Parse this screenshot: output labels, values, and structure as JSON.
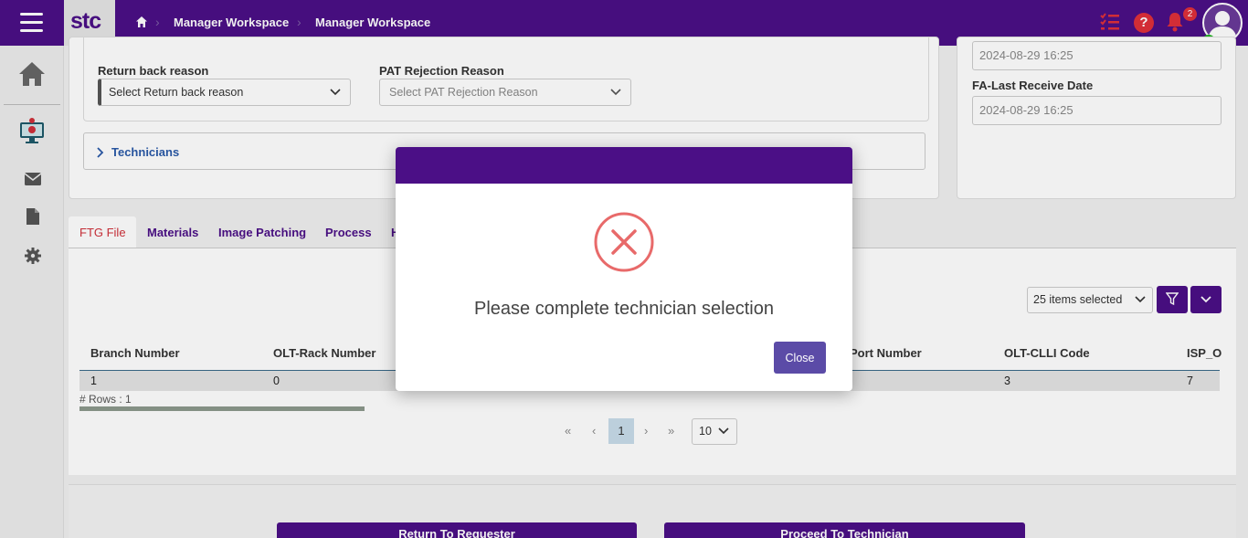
{
  "header": {
    "logo": "stc",
    "breadcrumbs": [
      "Manager Workspace",
      "Manager Workspace"
    ],
    "notification_count": "2"
  },
  "form": {
    "return_reason_label": "Return back reason",
    "return_reason_value": "Select Return back reason",
    "pat_label": "PAT Rejection Reason",
    "pat_value": "Select PAT Rejection Reason",
    "technicians_label": "Technicians"
  },
  "side_panel": {
    "date1_value": "2024-08-29 16:25",
    "date2_label": "FA-Last Receive Date",
    "date2_value": "2024-08-29 16:25"
  },
  "tabs": [
    {
      "label": "FTG File",
      "active": true
    },
    {
      "label": "Materials"
    },
    {
      "label": "Image Patching"
    },
    {
      "label": "Process"
    },
    {
      "label": "H"
    }
  ],
  "table": {
    "items_selected": "25 items selected",
    "columns": [
      "Branch Number",
      "OLT-Rack Number",
      "Port Number",
      "OLT-CLLI Code",
      "ISP_O"
    ],
    "row": [
      "1",
      "0",
      "3",
      "7"
    ],
    "rows_count": "# Rows : 1"
  },
  "pagination": {
    "first": "«",
    "prev": "‹",
    "current": "1",
    "next": "›",
    "last": "»",
    "page_size": "10"
  },
  "actions": {
    "return_label": "Return To Requester",
    "proceed_label": "Proceed To Technician"
  },
  "modal": {
    "message": "Please complete technician selection",
    "close_label": "Close"
  },
  "colors": {
    "brand": "#4b0f86",
    "error": "#e86a6a",
    "alert": "#e0303a",
    "online": "#1db31d",
    "close_button": "#5b4ba7"
  }
}
